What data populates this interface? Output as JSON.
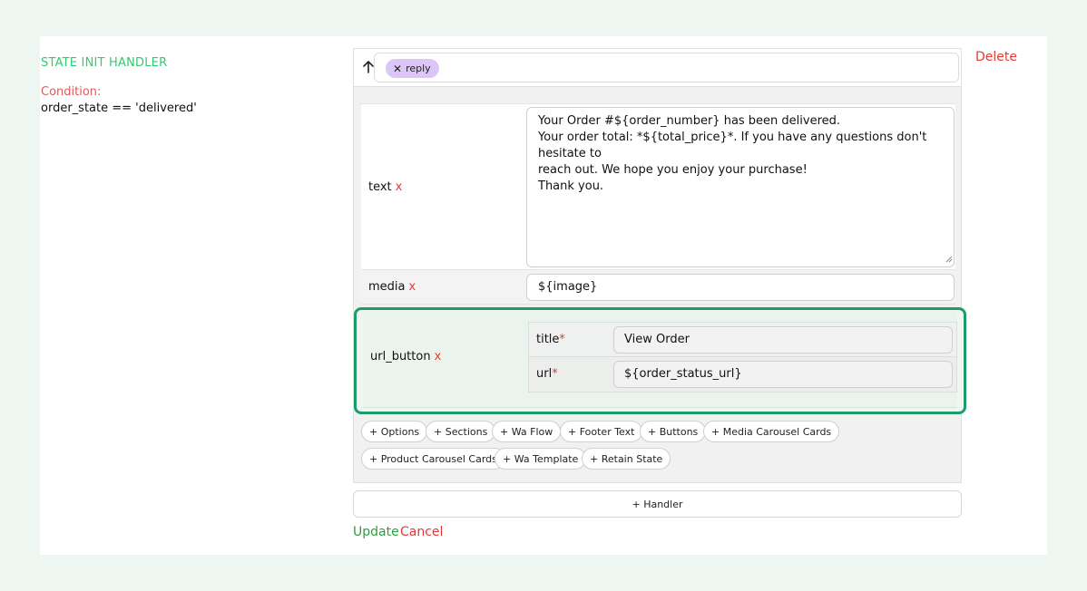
{
  "handler": {
    "title": "STATE INIT HANDLER",
    "condition_label": "Condition:",
    "condition_value": "order_state == 'delivered'",
    "delete_label": "Delete"
  },
  "editor": {
    "chip_label": "reply",
    "chip_remove_glyph": "✕",
    "up_icon": "arrow-up-icon",
    "remove_glyph": "x",
    "fields": {
      "text": {
        "label": "text",
        "value": "Your Order #${order_number} has been delivered.\nYour order total: *${total_price}*. If you have any questions don't hesitate to\nreach out. We hope you enjoy your purchase!\nThank you."
      },
      "media": {
        "label": "media",
        "value": "${image}"
      },
      "url_button": {
        "label": "url_button",
        "title_label": "title",
        "title_value": "View Order",
        "url_label": "url",
        "url_value": "${order_status_url}",
        "required_mark": "*"
      }
    },
    "add_buttons": [
      "+ Options",
      "+ Sections",
      "+ Wa Flow",
      "+ Footer Text",
      "+ Buttons",
      "+ Media Carousel Cards",
      "+ Product Carousel Cards",
      "+ Wa Template",
      "+ Retain State"
    ]
  },
  "actions": {
    "add_handler": "+ Handler",
    "update": "Update",
    "cancel": "Cancel"
  },
  "colors": {
    "accent_green": "#2ecc71",
    "highlight_border": "#1e9c6c",
    "danger_red": "#e53935",
    "chip_purple": "#dcc6f7"
  }
}
